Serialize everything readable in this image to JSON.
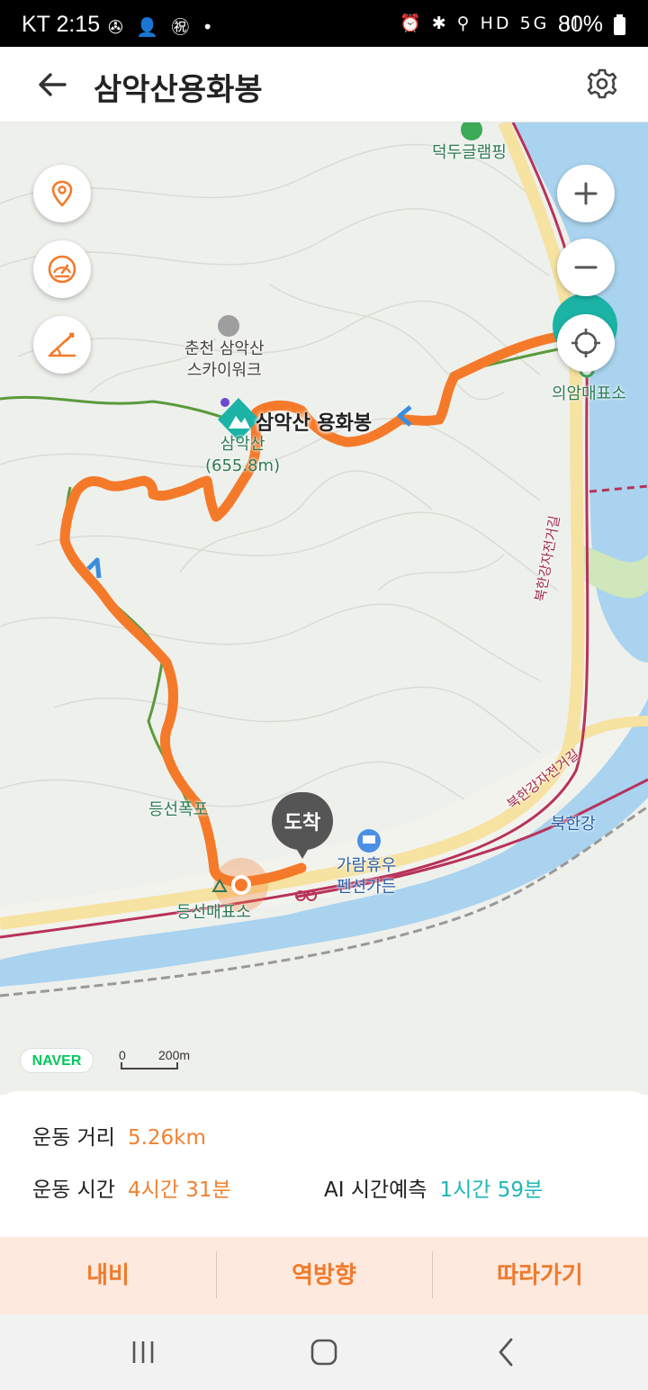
{
  "status_bar": {
    "time": "KT 2:15",
    "left_icons": "✇ 👤 ㊗ •",
    "right_icons": "⏰ ✱ ⚲ HD 5G .ıl",
    "battery": "80%"
  },
  "header": {
    "title": "삼악산용화봉"
  },
  "map": {
    "labels": {
      "glamping": "덕두글램핑",
      "skywalk_line1": "춘천 삼악산",
      "skywalk_line2": "스카이워크",
      "peak_name": "삼악산 용화봉",
      "mountain_line1": "삼악산",
      "mountain_line2": "(655.8m)",
      "uiam_store": "의암매표소",
      "trail_entrance": "등선폭포",
      "deungseon_store": "등선매표소",
      "pension_line1": "가람휴우",
      "pension_line2": "펜션가든",
      "river": "북한강",
      "bike_road_1": "북한강자전거길",
      "bike_road_2": "북한강자전거길"
    },
    "arrival_marker": "도착",
    "naver_logo": "NAVER",
    "scale_zero": "0",
    "scale_distance": "200m",
    "colors": {
      "track": "#f47a2a",
      "trail": "#5a9a3c",
      "river": "#a9d3ee",
      "road": "#b8325a",
      "teal": "#1bb3a6"
    }
  },
  "info": {
    "distance_label": "운동 거리",
    "distance_value": "5.26km",
    "time_label": "운동 시간",
    "time_value": "4시간 31분",
    "ai_label": "AI 시간예측",
    "ai_value": "1시간 59분"
  },
  "actions": {
    "navigate": "내비",
    "reverse": "역방향",
    "follow": "따라가기"
  }
}
